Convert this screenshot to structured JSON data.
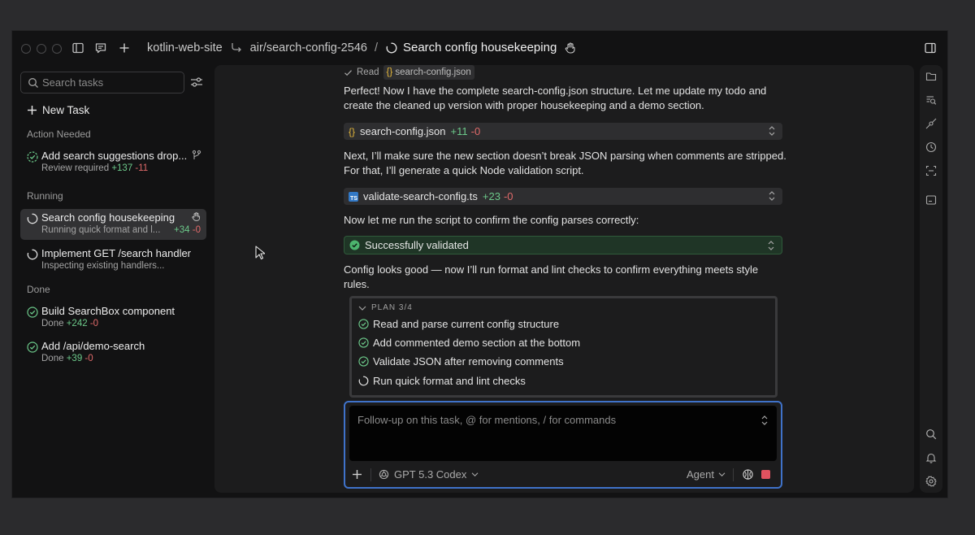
{
  "titlebar": {
    "repo": "kotlin-web-site",
    "branch": "air/search-config-2546",
    "separator": "/",
    "task_title": "Search config housekeeping"
  },
  "sidebar": {
    "search_placeholder": "Search tasks",
    "new_task_label": "New Task",
    "sections": {
      "action_needed": "Action Needed",
      "running": "Running",
      "done": "Done"
    },
    "tasks": [
      {
        "name": "Add search suggestions drop...",
        "sub": "Review required",
        "plus": "+137",
        "minus": "-11",
        "status": "review"
      },
      {
        "name": "Search config housekeeping",
        "sub": "Running quick format and l...",
        "plus": "+34",
        "minus": "-0",
        "status": "running"
      },
      {
        "name": "Implement GET /search handler",
        "sub": "Inspecting existing handlers...",
        "plus": "",
        "minus": "",
        "status": "running"
      },
      {
        "name": "Build SearchBox component",
        "sub": "Done",
        "plus": "+242",
        "minus": "-0",
        "status": "done"
      },
      {
        "name": "Add /api/demo-search",
        "sub": "Done",
        "plus": "+39",
        "minus": "-0",
        "status": "done"
      }
    ]
  },
  "conversation": {
    "read_label": "Read",
    "read_file": "search-config.json",
    "msg1": "Perfect! Now I have the complete search-config.json structure. Let me update my todo and create the cleaned up version with proper housekeeping and a demo section.",
    "file1": {
      "name": "search-config.json",
      "plus": "+11",
      "minus": "-0"
    },
    "msg2": "Next, I’ll make sure the new section doesn’t break JSON parsing when comments are stripped. For that, I’ll generate a quick Node validation script.",
    "file2": {
      "name": "validate-search-config.ts",
      "plus": "+23",
      "minus": "-0"
    },
    "msg3": "Now let me run the script to confirm the config parses correctly:",
    "validated": "Successfully validated",
    "msg4": "Config looks good — now I’ll run format and lint checks to confirm everything meets style rules."
  },
  "plan": {
    "header": "PLAN 3/4",
    "steps": [
      {
        "label": "Read and parse current config structure",
        "done": true
      },
      {
        "label": "Add commented demo section at the bottom",
        "done": true
      },
      {
        "label": "Validate JSON after removing comments",
        "done": true
      },
      {
        "label": "Run quick format and lint checks",
        "done": false
      }
    ]
  },
  "composer": {
    "placeholder": "Follow-up on this task, @ for mentions, / for commands",
    "model": "GPT 5.3 Codex",
    "mode": "Agent"
  },
  "colors": {
    "accent_blue": "#3f72c9",
    "added_green": "#6cc98a",
    "removed_red": "#e06a6a",
    "stop_red": "#e0525f"
  }
}
